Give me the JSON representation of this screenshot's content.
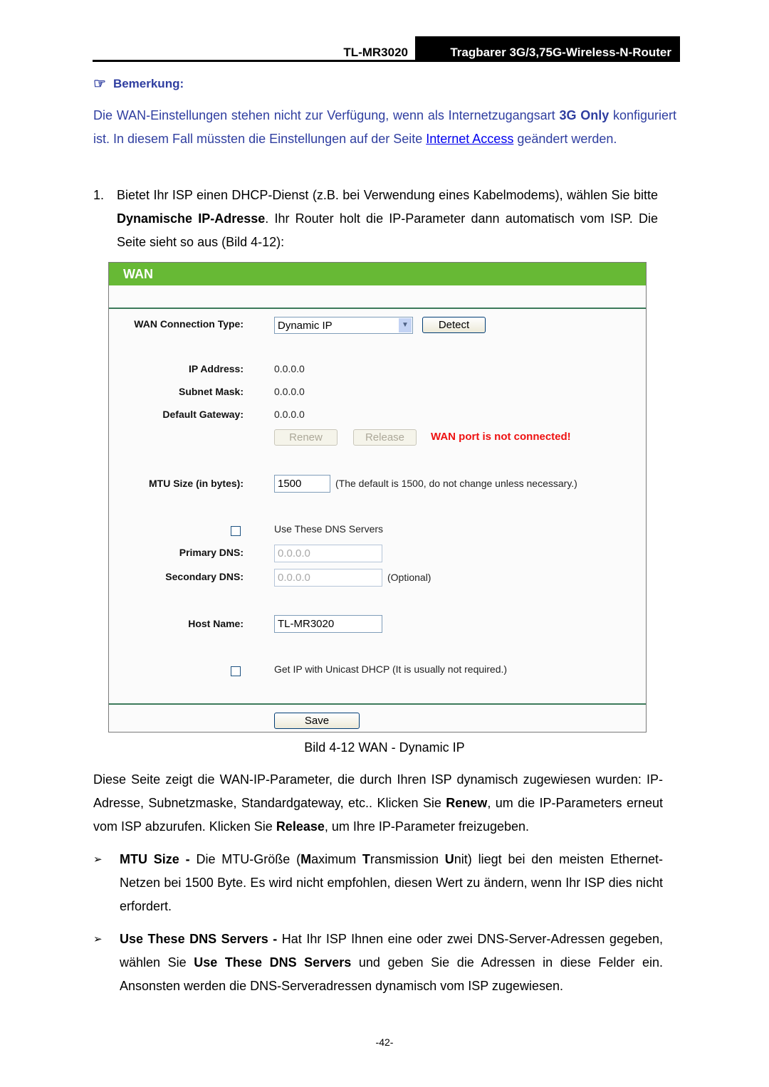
{
  "header": {
    "model": "TL-MR3020",
    "title": "Tragbarer 3G/3,75G-Wireless-N-Router"
  },
  "note": {
    "icon": "pointing-hand-icon",
    "heading": "Bemerkung:",
    "text_1": "Die WAN-Einstellungen stehen nicht zur Verfügung, wenn als Internetzugangsart ",
    "bold_1": "3G Only",
    "text_2": " konfiguriert ist. In diesem Fall müssten die Einstellungen auf der Seite ",
    "link": "Internet Access",
    "text_3": " geändert werden."
  },
  "step1": {
    "number": "1.",
    "text_1": "Bietet Ihr ISP einen DHCP-Dienst (z.B. bei Verwendung eines Kabelmodems), wählen Sie bitte ",
    "bold_1": "Dynamische IP-Adresse",
    "text_2": ". Ihr Router holt die IP-Parameter dann automatisch vom ISP. Die Seite sieht so aus (Bild 4-12):"
  },
  "wan": {
    "title": "WAN",
    "connection_type_label": "WAN Connection Type:",
    "connection_type_value": "Dynamic IP",
    "detect_label": "Detect",
    "ip_label": "IP Address:",
    "ip_value": "0.0.0.0",
    "mask_label": "Subnet Mask:",
    "mask_value": "0.0.0.0",
    "gateway_label": "Default Gateway:",
    "gateway_value": "0.0.0.0",
    "renew_label": "Renew",
    "release_label": "Release",
    "error_text": "WAN port is not connected!",
    "mtu_label": "MTU Size (in bytes):",
    "mtu_value": "1500",
    "mtu_hint": "(The default is 1500, do not change unless necessary.)",
    "use_dns_label": "Use These DNS Servers",
    "use_dns_checked": false,
    "primary_dns_label": "Primary DNS:",
    "primary_dns_value": "0.0.0.0",
    "secondary_dns_label": "Secondary DNS:",
    "secondary_dns_value": "0.0.0.0",
    "secondary_dns_hint": "(Optional)",
    "host_name_label": "Host Name:",
    "host_name_value": "TL-MR3020",
    "unicast_label": "Get IP with Unicast DHCP (It is usually not required.)",
    "unicast_checked": false,
    "save_label": "Save"
  },
  "caption": "Bild 4-12 WAN - Dynamic IP",
  "para": {
    "text_1": "Diese Seite zeigt die WAN-IP-Parameter, die durch Ihren ISP dynamisch zugewiesen wurden: IP-Adresse, Subnetzmaske, Standardgateway, etc.. Klicken Sie ",
    "bold_1": "Renew",
    "text_2": ", um die IP-Parameters erneut vom ISP abzurufen. Klicken Sie ",
    "bold_2": "Release",
    "text_3": ", um Ihre IP-Parameter freizugeben."
  },
  "bullets": [
    {
      "mark": "➢",
      "bold": "MTU Size -",
      "text_a": " Die MTU-Größe (",
      "m": "M",
      "text_b": "aximum ",
      "t": "T",
      "text_c": "ransmission ",
      "u": "U",
      "text_d": "nit) liegt bei den meisten Ethernet-Netzen bei 1500 Byte. Es wird nicht empfohlen, diesen Wert zu ändern, wenn Ihr ISP dies nicht erfordert."
    },
    {
      "mark": "➢",
      "bold": "Use These DNS Servers -",
      "text_a": " Hat Ihr ISP Ihnen eine oder zwei DNS-Server-Adressen gegeben, wählen Sie ",
      "bold_2": "Use These DNS Servers",
      "text_b": " und geben Sie die Adressen in diese Felder ein. Ansonsten werden die DNS-Serveradressen dynamisch vom ISP zugewiesen."
    }
  ],
  "page_number": "-42-"
}
